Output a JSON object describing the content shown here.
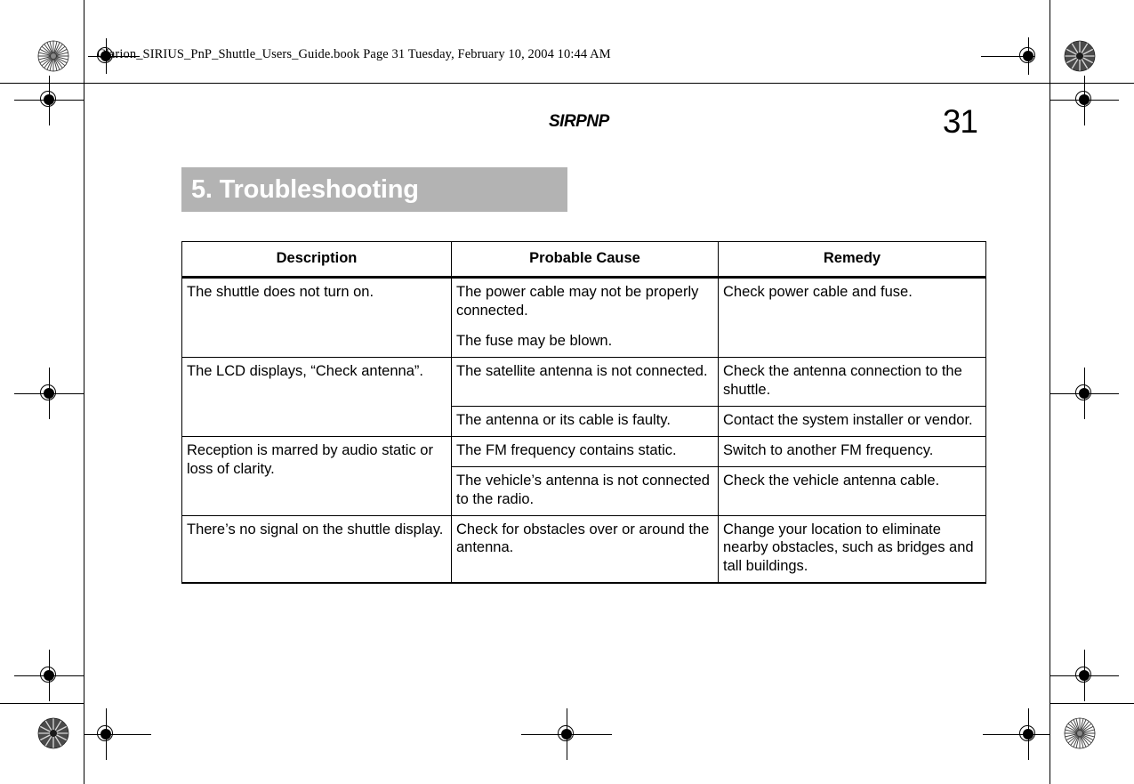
{
  "book_header": "Clarion_SIRIUS_PnP_Shuttle_Users_Guide.book  Page 31  Tuesday, February 10, 2004  10:44 AM",
  "page": {
    "doc_title": "SIRPNP",
    "folio": "31",
    "chapter_title": "5. Troubleshooting",
    "banner_color": "#b3b3b3"
  },
  "table": {
    "headers": [
      "Description",
      "Probable Cause",
      "Remedy"
    ],
    "rows": [
      {
        "description": "The shuttle does not turn on.",
        "description_rowspan": 1,
        "causes": [
          {
            "cause_paragraphs": [
              "The power cable may not be",
              "The fuse may be blown."
            ],
            "cause": "The power cable may not be properly connected.",
            "cause_extra": "The fuse may be blown.",
            "remedy": "Check power cable and fuse."
          }
        ]
      },
      {
        "description": "The LCD displays, “Check antenna”.",
        "description_rowspan": 2,
        "causes": [
          {
            "cause": "The satellite antenna is not connected.",
            "remedy": "Check the antenna connection to the shuttle."
          },
          {
            "cause": "The antenna or its cable is faulty.",
            "remedy": "Contact the system installer or vendor."
          }
        ]
      },
      {
        "description": "Reception is marred by audio static or loss of clarity.",
        "description_rowspan": 2,
        "causes": [
          {
            "cause": "The FM frequency contains static.",
            "remedy": "Switch to another FM frequency."
          },
          {
            "cause": "The vehicle’s antenna is not connected to the radio.",
            "remedy": "Check the vehicle antenna cable."
          }
        ]
      },
      {
        "description": "There’s no signal on the shuttle display.",
        "description_rowspan": 1,
        "causes": [
          {
            "cause": "Check for obstacles over or around the antenna.",
            "remedy": "Change your location to eliminate nearby obstacles, such as bridges and tall buildings."
          }
        ]
      }
    ]
  },
  "print_marks": {
    "registration_label": "registration-target",
    "rosette_label": "color-rosette-target"
  }
}
